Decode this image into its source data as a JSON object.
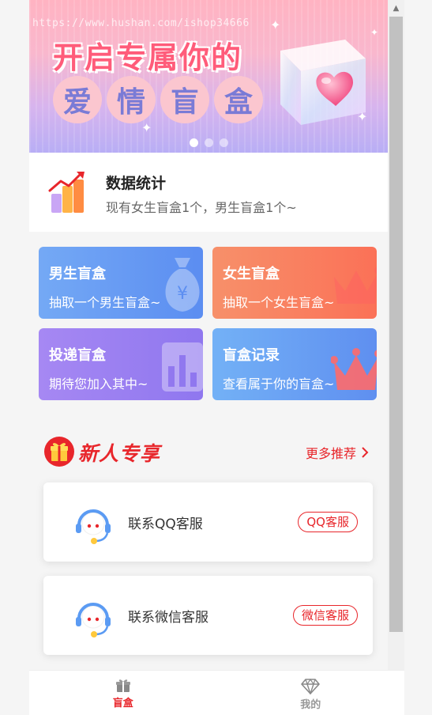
{
  "banner": {
    "watermark": "https://www.hushan.com/ishop34666",
    "line1": "开启专属你的",
    "line2_chars": [
      "爱",
      "情",
      "盲",
      "盒"
    ],
    "active_slide": 1,
    "slide_count": 3
  },
  "stats": {
    "title": "数据统计",
    "subtitle": "现有女生盲盒1个，男生盲盒1个~"
  },
  "cards": {
    "boy": {
      "title": "男生盲盒",
      "desc": "抽取一个男生盲盒~"
    },
    "girl": {
      "title": "女生盲盒",
      "desc": "抽取一个女生盲盒~"
    },
    "post": {
      "title": "投递盲盒",
      "desc": "期待您加入其中~"
    },
    "record": {
      "title": "盲盒记录",
      "desc": "查看属于你的盲盒~"
    }
  },
  "section": {
    "title": "新人专享",
    "more": "更多推荐"
  },
  "services": {
    "qq": {
      "label": "联系QQ客服",
      "button": "QQ客服"
    },
    "wechat": {
      "label": "联系微信客服",
      "button": "微信客服"
    }
  },
  "tabbar": {
    "home": "盲盒",
    "mine": "我的"
  },
  "colors": {
    "accent": "#e8262b",
    "boy_card": "#5b8df1",
    "girl_card": "#fb7157",
    "post_card": "#8f77ef",
    "record_card": "#5f8ff0"
  },
  "icons": {
    "stats": "bar-chart-icon",
    "qq": "headset-icon",
    "wechat": "headset-icon",
    "home_tab": "gift-icon",
    "mine_tab": "diamond-icon",
    "more": "chevron-right-icon"
  }
}
